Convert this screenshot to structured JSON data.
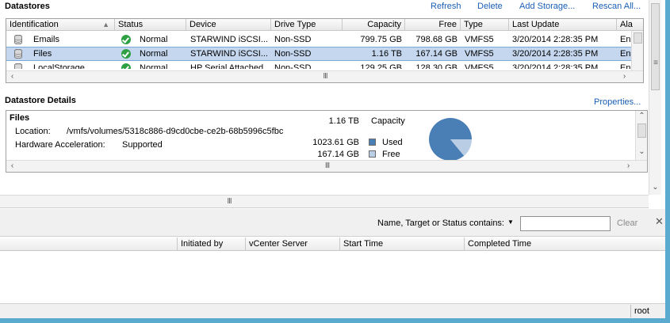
{
  "datastores": {
    "title": "Datastores",
    "actions": {
      "refresh": "Refresh",
      "delete": "Delete",
      "add": "Add Storage...",
      "rescan": "Rescan All..."
    },
    "columns": [
      "Identification",
      "Status",
      "Device",
      "Drive Type",
      "Capacity",
      "Free",
      "Type",
      "Last Update",
      "Ala"
    ],
    "rows": [
      {
        "name": "Emails",
        "status": "Normal",
        "device": "STARWIND iSCSI...",
        "drive_type": "Non-SSD",
        "capacity": "799.75 GB",
        "free": "798.68 GB",
        "type": "VMFS5",
        "last_update": "3/20/2014 2:28:35 PM",
        "alarm": "Ena"
      },
      {
        "name": "Files",
        "status": "Normal",
        "device": "STARWIND iSCSI...",
        "drive_type": "Non-SSD",
        "capacity": "1.16 TB",
        "free": "167.14 GB",
        "type": "VMFS5",
        "last_update": "3/20/2014 2:28:35 PM",
        "alarm": "Ena",
        "selected": true
      },
      {
        "name": "LocalStorage",
        "status": "Normal",
        "device": "HP Serial Attached...",
        "drive_type": "Non-SSD",
        "capacity": "129.25 GB",
        "free": "128.30 GB",
        "type": "VMFS5",
        "last_update": "3/20/2014 2:28:35 PM",
        "alarm": "Ena"
      }
    ]
  },
  "details": {
    "title": "Datastore Details",
    "properties_link": "Properties...",
    "name": "Files",
    "location_label": "Location:",
    "location_value": "/vmfs/volumes/5318c886-d9cd0cbe-ce2b-68b5996c5fbc",
    "hw_label": "Hardware Acceleration:",
    "hw_value": "Supported",
    "capacity_value": "1.16 TB",
    "capacity_label": "Capacity",
    "used_value": "1023.61 GB",
    "used_label": "Used",
    "free_value": "167.14 GB",
    "free_label": "Free",
    "used_fraction": 0.86,
    "used_color": "#4a7fb5",
    "free_color": "#b9cde5"
  },
  "tasks": {
    "filter_label": "Name, Target or Status contains:",
    "filter_value": "",
    "clear_label": "Clear",
    "columns": [
      "Initiated by",
      "vCenter Server",
      "Start Time",
      "Completed Time"
    ]
  },
  "status_bar": {
    "user": "root"
  }
}
